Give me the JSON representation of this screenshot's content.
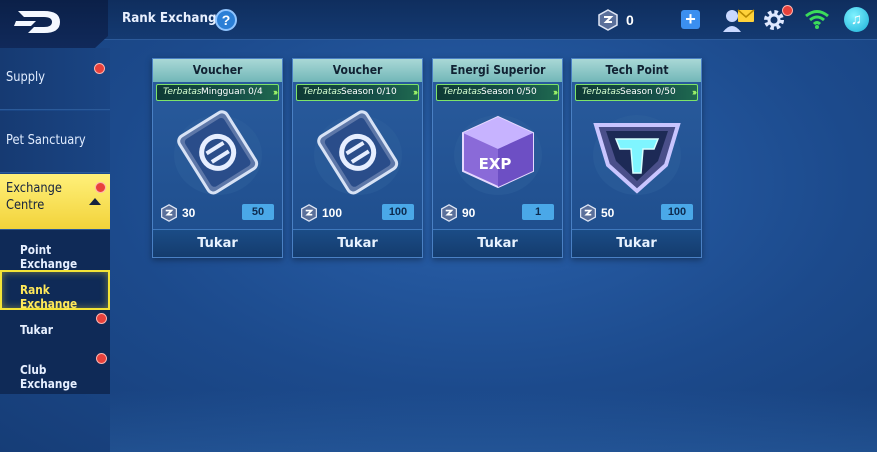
{
  "header": {
    "title": "Rank Exchange",
    "help_label": "?",
    "currency_value": "0",
    "add_label": "+"
  },
  "sidebar": {
    "items": [
      {
        "label": "Supply",
        "has_dot": true
      },
      {
        "label": "Pet Sanctuary",
        "has_dot": false
      },
      {
        "label": "Exchange Centre",
        "has_dot": true,
        "active": true
      }
    ],
    "subitems": [
      {
        "label": "Point Exchange",
        "has_dot": false
      },
      {
        "label": "Rank Exchange",
        "has_dot": false,
        "selected": true
      },
      {
        "label": "Tukar",
        "has_dot": true
      },
      {
        "label": "Club Exchange",
        "has_dot": true
      }
    ]
  },
  "cards": [
    {
      "title": "Voucher",
      "limit_tag": "Terbatas",
      "limit_text": "Mingguan 0/4",
      "cost": "30",
      "stock": "50",
      "button": "Tukar",
      "art": "voucher-icon"
    },
    {
      "title": "Voucher",
      "limit_tag": "Terbatas",
      "limit_text": "Season 0/10",
      "cost": "100",
      "stock": "100",
      "button": "Tukar",
      "art": "voucher-icon"
    },
    {
      "title": "Energi Superior",
      "limit_tag": "Terbatas",
      "limit_text": "Season 0/50",
      "cost": "90",
      "stock": "1",
      "button": "Tukar",
      "art": "exp-cube-icon"
    },
    {
      "title": "Tech Point",
      "limit_tag": "Terbatas",
      "limit_text": "Season 0/50",
      "cost": "50",
      "stock": "100",
      "button": "Tukar",
      "art": "tech-point-icon"
    }
  ],
  "colors": {
    "accent_yellow": "#f2d33a",
    "card_header": "#a9d8d6",
    "limit_border": "#7de36a",
    "notify_red": "#e8413b"
  }
}
